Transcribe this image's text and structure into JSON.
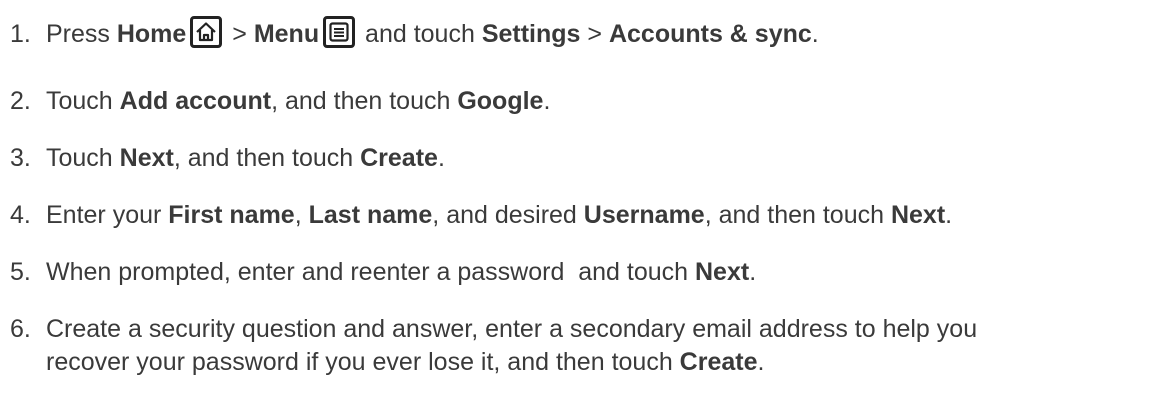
{
  "steps": [
    {
      "number": "1.",
      "parts": {
        "t1": "Press ",
        "b1": "Home",
        "t2": " > ",
        "b2": "Menu",
        "t3": " and touch ",
        "b3": "Settings",
        "t4": " > ",
        "b4": "Accounts & sync",
        "t5": "."
      },
      "icons": [
        "home-key-icon",
        "menu-key-icon"
      ]
    },
    {
      "number": "2.",
      "parts": {
        "t1": "Touch ",
        "b1": "Add account",
        "t2": ", and then touch ",
        "b2": "Google",
        "t3": "."
      }
    },
    {
      "number": "3.",
      "parts": {
        "t1": "Touch ",
        "b1": "Next",
        "t2": ", and then touch ",
        "b2": "Create",
        "t3": "."
      }
    },
    {
      "number": "4.",
      "parts": {
        "t1": "Enter your ",
        "b1": "First name",
        "t2": ", ",
        "b2": "Last name",
        "t3": ", and desired ",
        "b3": "Username",
        "t4": ", and then touch ",
        "b4": "Next",
        "t5": "."
      }
    },
    {
      "number": "5.",
      "parts": {
        "t1": "When prompted, enter and reenter a password  and touch ",
        "b1": "Next",
        "t2": "."
      }
    },
    {
      "number": "6.",
      "parts": {
        "line1": "Create a security question and answer, enter a secondary email address to help you",
        "t1": "recover your password if you ever lose it, and then touch ",
        "b1": "Create",
        "t2": "."
      }
    }
  ],
  "colors": {
    "text": "#3a3a3a",
    "icon_border": "#222222",
    "background": "#ffffff"
  }
}
